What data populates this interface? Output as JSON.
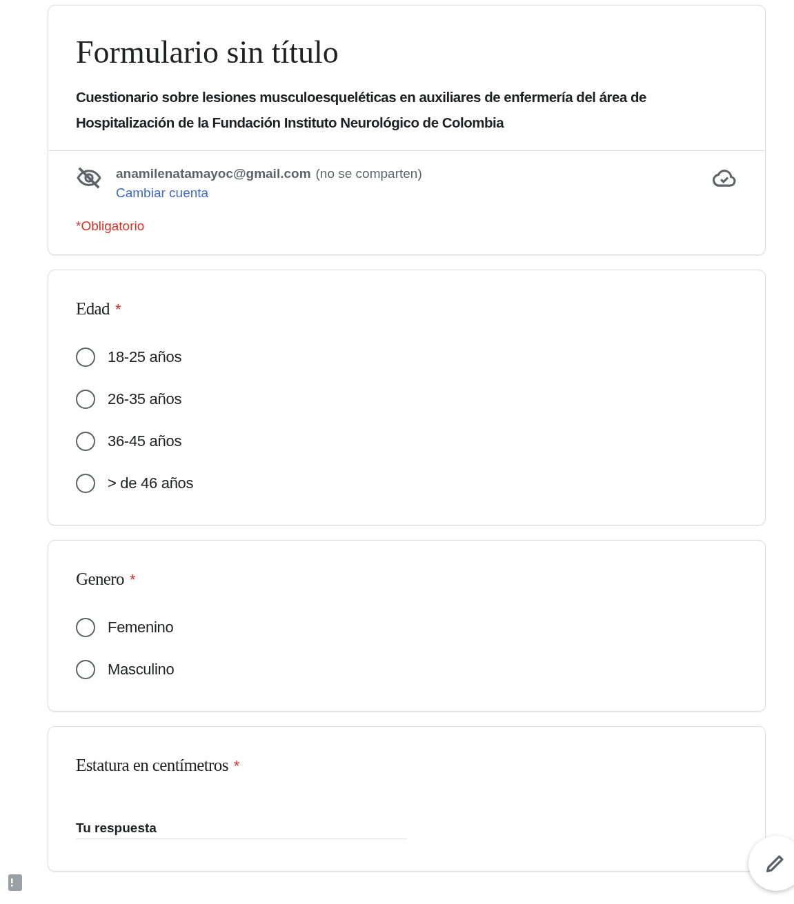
{
  "form": {
    "title": "Formulario sin título",
    "description": "Cuestionario sobre lesiones musculoesqueléticas en auxiliares de enfermería del área de Hospitalización de la Fundación Instituto Neurológico de Colombia",
    "account": {
      "email": "anamilenatamayoc@gmail.com",
      "note": "(no se comparten)",
      "switch_link": "Cambiar cuenta"
    },
    "required_note": "*Obligatorio"
  },
  "questions": [
    {
      "kind": "radio",
      "title": "Edad",
      "required_mark": "*",
      "options": [
        {
          "label": "18-25 años",
          "selected": false
        },
        {
          "label": "26-35 años",
          "selected": false
        },
        {
          "label": "36-45 años",
          "selected": false
        },
        {
          "label": "> de 46 años",
          "selected": false
        }
      ]
    },
    {
      "kind": "radio",
      "title": "Genero",
      "required_mark": "*",
      "options": [
        {
          "label": "Femenino",
          "selected": false
        },
        {
          "label": "Masculino",
          "selected": false
        }
      ]
    },
    {
      "kind": "text",
      "title": "Estatura en centímetros",
      "required_mark": "*",
      "placeholder": "Tu respuesta"
    }
  ]
}
